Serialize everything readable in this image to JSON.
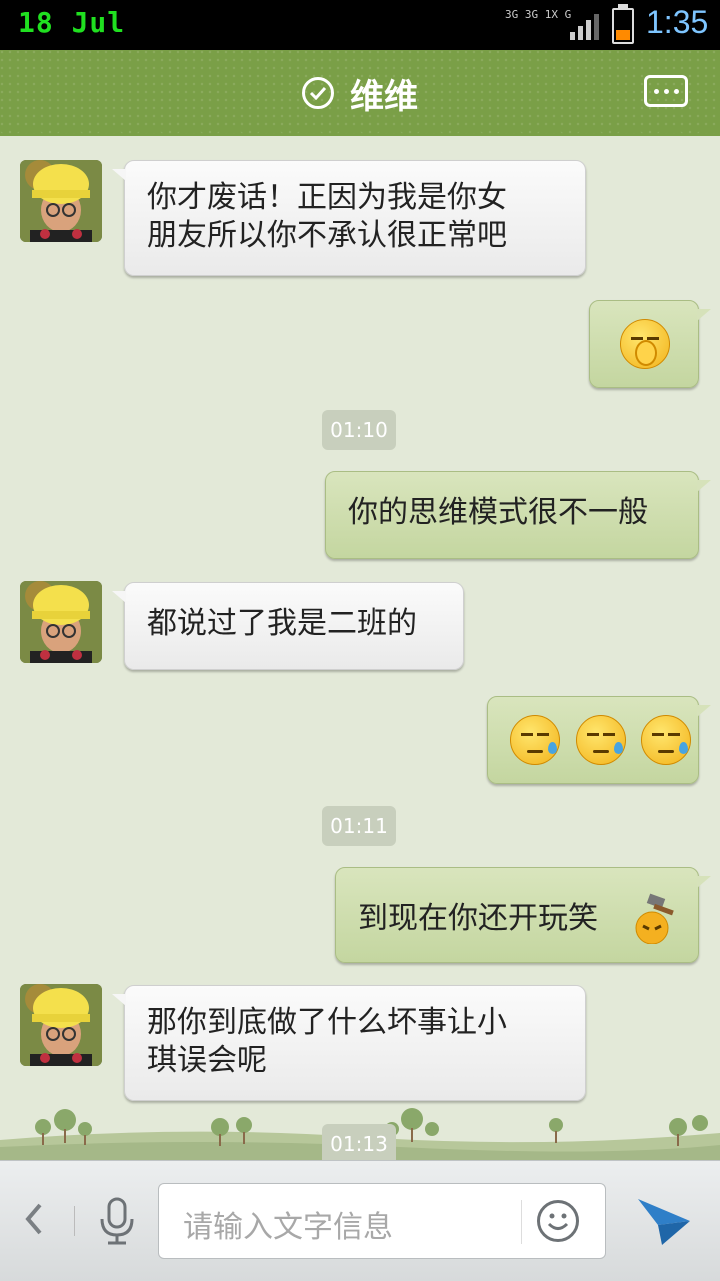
{
  "status_bar": {
    "date": "18 Jul",
    "network": "3G 3G 1X G",
    "time": "1:35",
    "battery_level": 0.35
  },
  "header": {
    "title": "维维",
    "verified_icon": "check-circle-icon",
    "more_icon": "more-icon"
  },
  "messages": [
    {
      "direction": "in",
      "text_line1": "你才废话！正因为我是你女",
      "text_line2": "朋友所以你不承认很正常吧"
    },
    {
      "direction": "out",
      "emoji": "cover-face-emoji"
    },
    {
      "timestamp": "01:10"
    },
    {
      "direction": "out",
      "text": "你的思维模式很不一般"
    },
    {
      "direction": "in",
      "text": "都说过了我是二班的"
    },
    {
      "direction": "out",
      "emoji": "sweat-emoji x3"
    },
    {
      "timestamp": "01:11"
    },
    {
      "direction": "out",
      "text": "到现在你还开玩笑"
    },
    {
      "direction": "in",
      "text_line1": "那你到底做了什么坏事让小",
      "text_line2": "琪误会呢"
    },
    {
      "timestamp": "01:13"
    }
  ],
  "input_bar": {
    "placeholder": "请输入文字信息",
    "back_icon": "chevron-left-icon",
    "mic_icon": "microphone-icon",
    "emoji_icon": "smiley-icon",
    "send_icon": "send-icon"
  },
  "colors": {
    "header": "#7a9f47",
    "chat_bg": "#e3e9d8",
    "bubble_out": "#cddcab",
    "bubble_in": "#f4f4f4",
    "time_color": "#7ec5ff"
  }
}
